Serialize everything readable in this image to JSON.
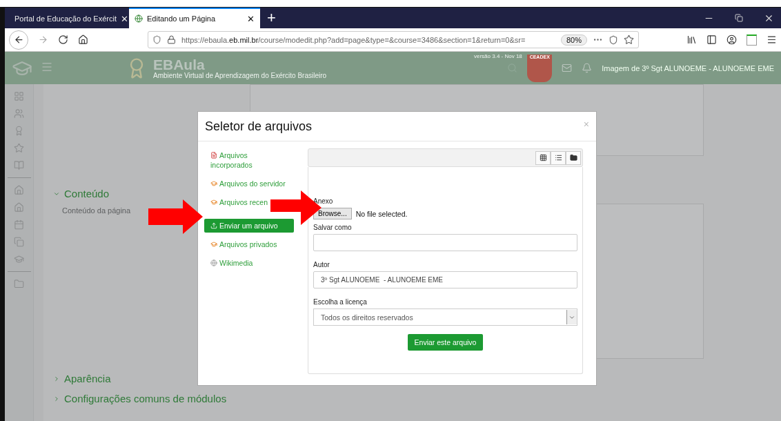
{
  "browser": {
    "tabs": [
      {
        "title": "Portal de Educação do Exércit",
        "selected": false,
        "close": "✕"
      },
      {
        "title": "Editando um Página",
        "selected": true,
        "close": "✕"
      }
    ],
    "new_tab": "+",
    "url": "https://ebaula.**eb.mil.br**/course/modedit.php?add=page&type=&course=3486&section=1&return=0&sr=",
    "zoom": "80%"
  },
  "site_header": {
    "title": "EBAula",
    "subtitle": "Ambiente Virtual de Aprendizagem do Exército Brasileiro",
    "version": "versão 3.4 - Nov 18",
    "badge": "CEADEX",
    "user": "Imagem de 3º Sgt ALUNOEME - ALUNOEME EME"
  },
  "page": {
    "sections": [
      {
        "title": "Conteúdo",
        "expanded": true
      },
      {
        "title": "Aparência",
        "expanded": false
      },
      {
        "title": "Configurações comuns de módulos",
        "expanded": false
      }
    ],
    "field_label": "Conteúdo da página"
  },
  "dialog": {
    "title": "Seletor de arquivos",
    "close": "×",
    "repositories": [
      {
        "label": "Arquivos incorporados",
        "kind": "embedded",
        "selected": false
      },
      {
        "label": "Arquivos do servidor",
        "kind": "repository",
        "selected": false
      },
      {
        "label": "Arquivos recen",
        "kind": "repository",
        "selected": false
      },
      {
        "label": "Enviar um arquivo",
        "kind": "upload",
        "selected": true
      },
      {
        "label": "Arquivos privados",
        "kind": "repository",
        "selected": false
      },
      {
        "label": "Wikimedia",
        "kind": "wikimedia",
        "selected": false
      }
    ],
    "form": {
      "attachment_label": "Anexo",
      "browse": "Browse...",
      "no_file": "No file selected.",
      "save_as_label": "Salvar como",
      "author_label": "Autor",
      "author": "3º Sgt ALUNOEME  - ALUNOEME EME",
      "license_label": "Escolha a licença",
      "license": "Todos os direitos reservados",
      "submit": "Enviar este arquivo"
    }
  }
}
